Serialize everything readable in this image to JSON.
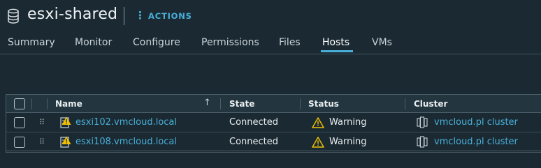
{
  "header": {
    "title": "esxi-shared",
    "actions_label": "ACTIONS",
    "icon": "datastore-icon"
  },
  "tabs": [
    {
      "label": "Summary"
    },
    {
      "label": "Monitor"
    },
    {
      "label": "Configure"
    },
    {
      "label": "Permissions"
    },
    {
      "label": "Files"
    },
    {
      "label": "Hosts",
      "active": true
    },
    {
      "label": "VMs"
    }
  ],
  "grid": {
    "columns": [
      {
        "label": "Name",
        "sort": "ascending"
      },
      {
        "label": "State"
      },
      {
        "label": "Status"
      },
      {
        "label": "Cluster"
      }
    ],
    "rows": [
      {
        "name": "esxi102.vmcloud.local",
        "state": "Connected",
        "status": "Warning",
        "cluster": "vmcloud.pl cluster",
        "name_icon": "host-warning-icon",
        "status_icon": "warning-triangle-icon",
        "cluster_icon": "cluster-icon"
      },
      {
        "name": "esxi108.vmcloud.local",
        "state": "Connected",
        "status": "Warning",
        "cluster": "vmcloud.pl cluster",
        "name_icon": "host-warning-icon",
        "status_icon": "warning-triangle-icon",
        "cluster_icon": "cluster-icon"
      }
    ]
  },
  "colors": {
    "background": "#1b2a32",
    "accent": "#49afd9",
    "warning": "#f2c200",
    "text": "#e8edf0"
  }
}
